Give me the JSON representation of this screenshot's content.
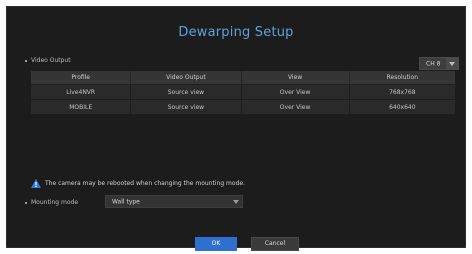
{
  "dialog": {
    "title": "Dewarping Setup",
    "video_output_label": "Video Output",
    "channel_select": {
      "value": "CH 8"
    },
    "table": {
      "headers": [
        "Profile",
        "Video Output",
        "View",
        "Resolution"
      ],
      "rows": [
        [
          "Live4NVR",
          "Source view",
          "Over View",
          "768x768"
        ],
        [
          "MOBILE",
          "Source view",
          "Over View",
          "640x640"
        ]
      ]
    },
    "warning_text": "The camera may be rebooted when changing the mounting mode.",
    "mounting_label": "Mounting mode",
    "mounting_select": {
      "value": "Wall type"
    },
    "ok_label": "OK",
    "cancel_label": "Cancel"
  },
  "colors": {
    "accent": "#2e6fcf",
    "title": "#5aa3e0",
    "warning": "#2f7de0",
    "background": "#1c1c1c"
  }
}
